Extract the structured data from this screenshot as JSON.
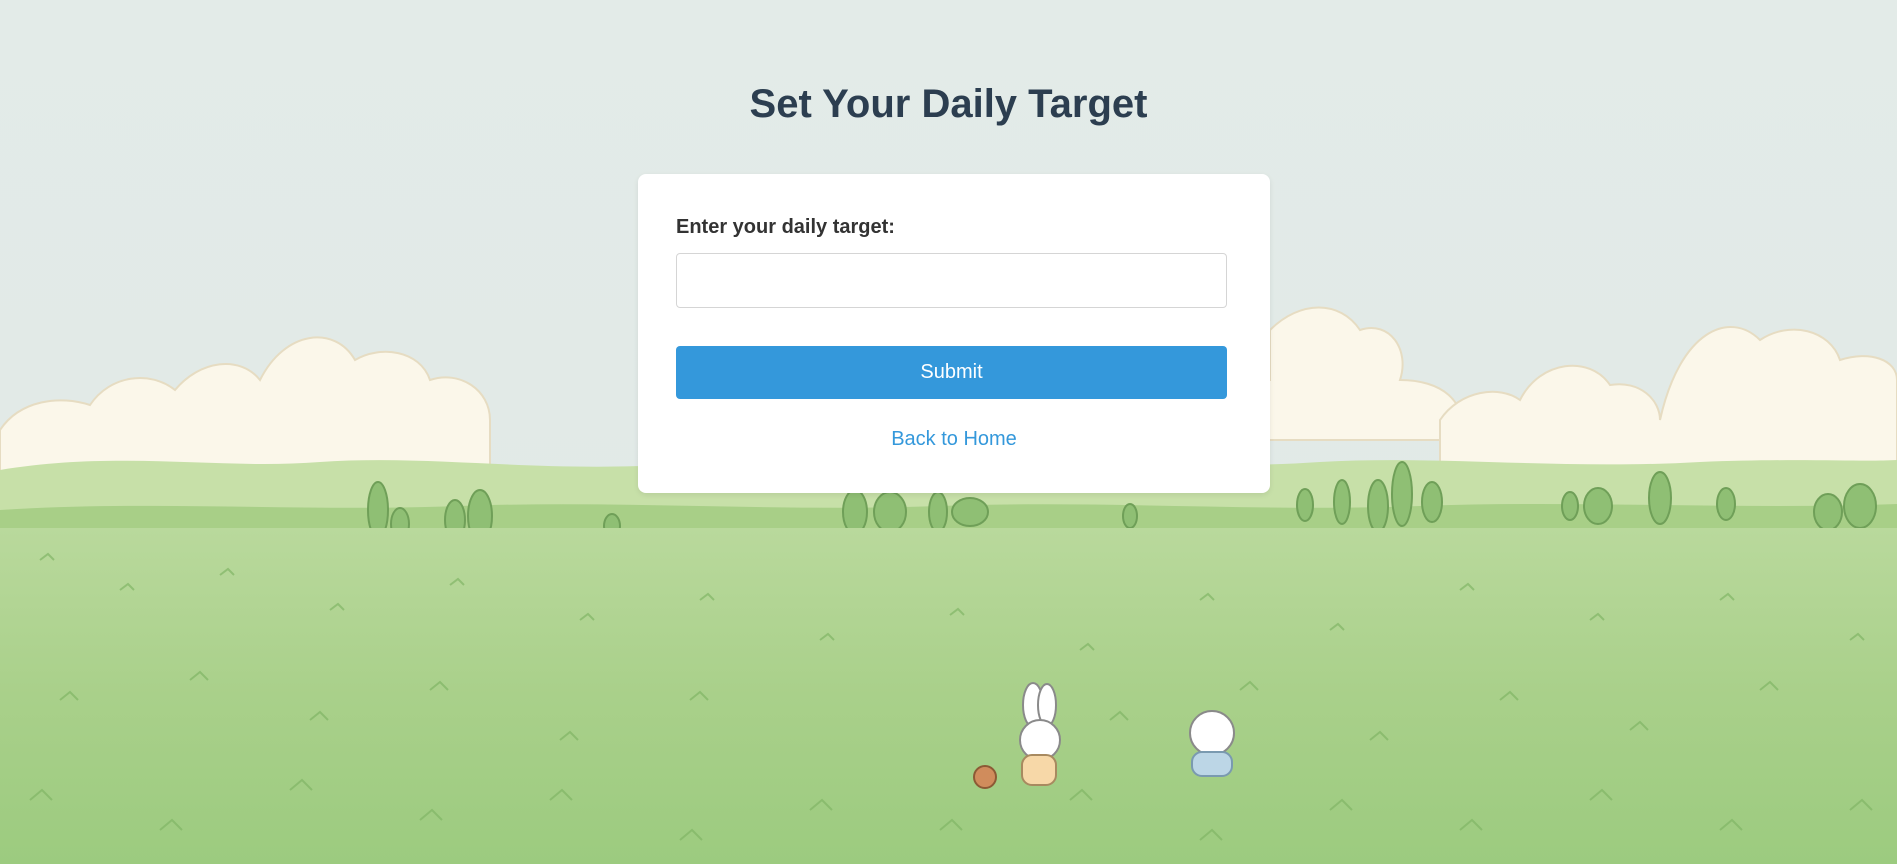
{
  "page": {
    "title": "Set Your Daily Target"
  },
  "form": {
    "label": "Enter your daily target:",
    "input_value": "",
    "input_placeholder": "",
    "submit_label": "Submit",
    "back_link_label": "Back to Home"
  },
  "colors": {
    "accent": "#3498db",
    "title": "#2c3e50",
    "sky": "#e5ecea",
    "field": "#a6cf86"
  },
  "background": {
    "icon": "meadow-landscape-illustration"
  }
}
